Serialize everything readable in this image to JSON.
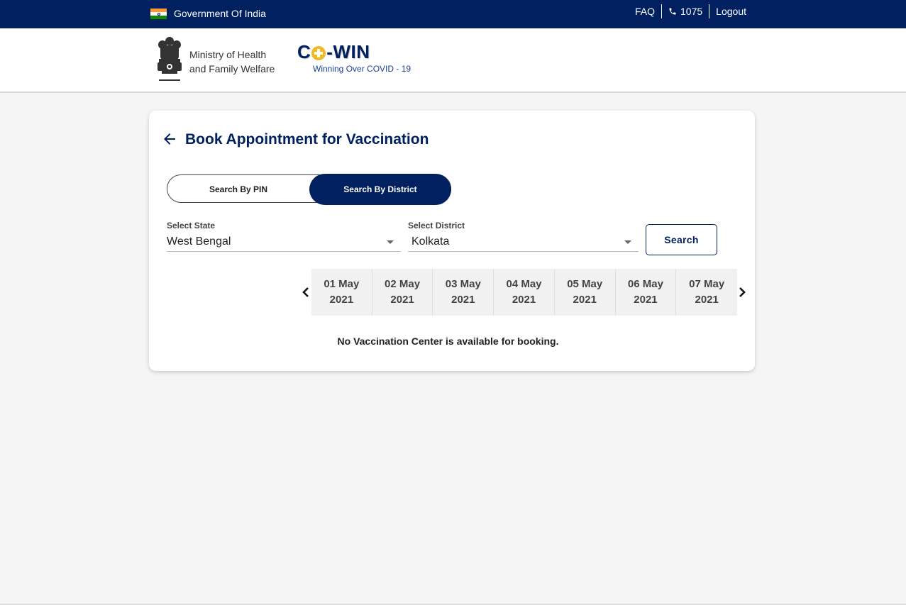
{
  "topbar": {
    "gov_label": "Government Of India",
    "links": [
      {
        "label": "FAQ",
        "icon": ""
      },
      {
        "label": "1075",
        "icon": "phone-icon"
      },
      {
        "label": "Logout",
        "icon": ""
      }
    ]
  },
  "header": {
    "ministry_line1": "Ministry of Health",
    "ministry_line2": "and Family Welfare",
    "logo_prefix": "C",
    "logo_suffix": "-WIN",
    "tagline": "Winning Over COVID - 19"
  },
  "booking": {
    "title": "Book Appointment for Vaccination",
    "tabs": [
      {
        "label": "Search By PIN",
        "active": false
      },
      {
        "label": "Search By District",
        "active": true
      }
    ],
    "state": {
      "label": "Select State",
      "value": "West Bengal"
    },
    "district": {
      "label": "Select District",
      "value": "Kolkata"
    },
    "search_label": "Search",
    "dates": [
      {
        "day": "01 May",
        "year": "2021"
      },
      {
        "day": "02 May",
        "year": "2021"
      },
      {
        "day": "03 May",
        "year": "2021"
      },
      {
        "day": "04 May",
        "year": "2021"
      },
      {
        "day": "05 May",
        "year": "2021"
      },
      {
        "day": "06 May",
        "year": "2021"
      },
      {
        "day": "07 May",
        "year": "2021"
      }
    ],
    "empty_message": "No Vaccination Center is available for booking."
  },
  "colors": {
    "primary": "#002060",
    "background": "#f5f5f5",
    "logo_accent": "#f2b820"
  }
}
